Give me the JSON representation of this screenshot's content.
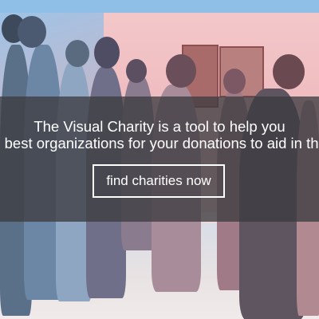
{
  "hero": {
    "headline_line1": "The Visual Charity is a tool to help you",
    "headline_line2": "find the best organizations for your donations to aid in the ebola",
    "cta_label": "find charities now",
    "image_description": "crowd-photo"
  },
  "colors": {
    "overlay": "#3c3c40",
    "text": "#ffffff",
    "topbar": "#8fbfe6"
  }
}
